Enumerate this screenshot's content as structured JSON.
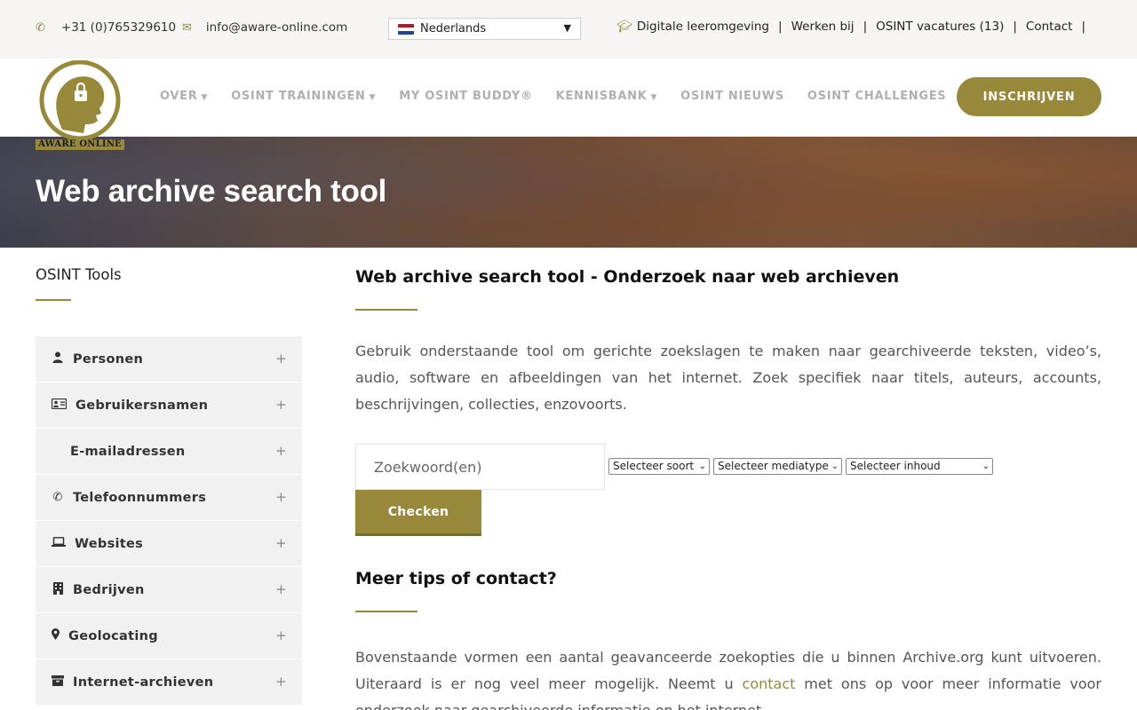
{
  "topbar": {
    "phone": "+31 (0)765329610",
    "email": "info@aware-online.com",
    "language": "Nederlands",
    "links": [
      "Digitale leeromgeving",
      "Werken bij",
      "OSINT vacatures (13)",
      "Contact"
    ]
  },
  "header": {
    "logo_text": "AWARE ONLINE",
    "nav": [
      {
        "label": "OVER",
        "dropdown": true
      },
      {
        "label": "OSINT TRAININGEN",
        "dropdown": true
      },
      {
        "label": "MY OSINT BUDDY®",
        "dropdown": false
      },
      {
        "label": "KENNISBANK",
        "dropdown": true
      },
      {
        "label": "OSINT NIEUWS",
        "dropdown": false
      },
      {
        "label": "OSINT CHALLENGES",
        "dropdown": false
      }
    ],
    "cta": "INSCHRIJVEN"
  },
  "hero": {
    "title": "Web archive search tool"
  },
  "sidebar": {
    "title": "OSINT Tools",
    "items": [
      {
        "label": "Personen",
        "icon": "user-icon"
      },
      {
        "label": "Gebruikersnamen",
        "icon": "id-card-icon"
      },
      {
        "label": "E-mailadressen",
        "icon": ""
      },
      {
        "label": "Telefoonnummers",
        "icon": "phone-icon"
      },
      {
        "label": "Websites",
        "icon": "laptop-icon"
      },
      {
        "label": "Bedrijven",
        "icon": "building-icon"
      },
      {
        "label": "Geolocating",
        "icon": "map-marker-icon"
      },
      {
        "label": "Internet-archieven",
        "icon": "archive-icon"
      }
    ]
  },
  "main": {
    "title": "Web archive search tool - Onderzoek naar web archieven",
    "intro": "Gebruik onderstaande tool om gerichte zoekslagen te maken naar gearchiveerde teksten, video’s, audio, software en afbeeldingen van het internet. Zoek specifiek naar titels, auteurs, accounts, beschrijvingen, collecties, enzovoorts.",
    "search_placeholder": "Zoekwoord(en)",
    "selects": [
      "Selecteer soort",
      "Selecteer mediatype",
      "Selecteer inhoud"
    ],
    "button": "Checken",
    "sub_title": "Meer tips of contact?",
    "outro_before": "Bovenstaande vormen een aantal geavanceerde zoekopties die u binnen Archive.org kunt uitvoeren. Uiteraard is er nog veel meer mogelijk. Neemt u ",
    "outro_link": "contact",
    "outro_after": " met ons op voor meer informatie voor onderzoek naar gearchiveerde informatie op het internet."
  },
  "colors": {
    "accent": "#97883a",
    "sidebar_bg": "#f1f1f1"
  }
}
